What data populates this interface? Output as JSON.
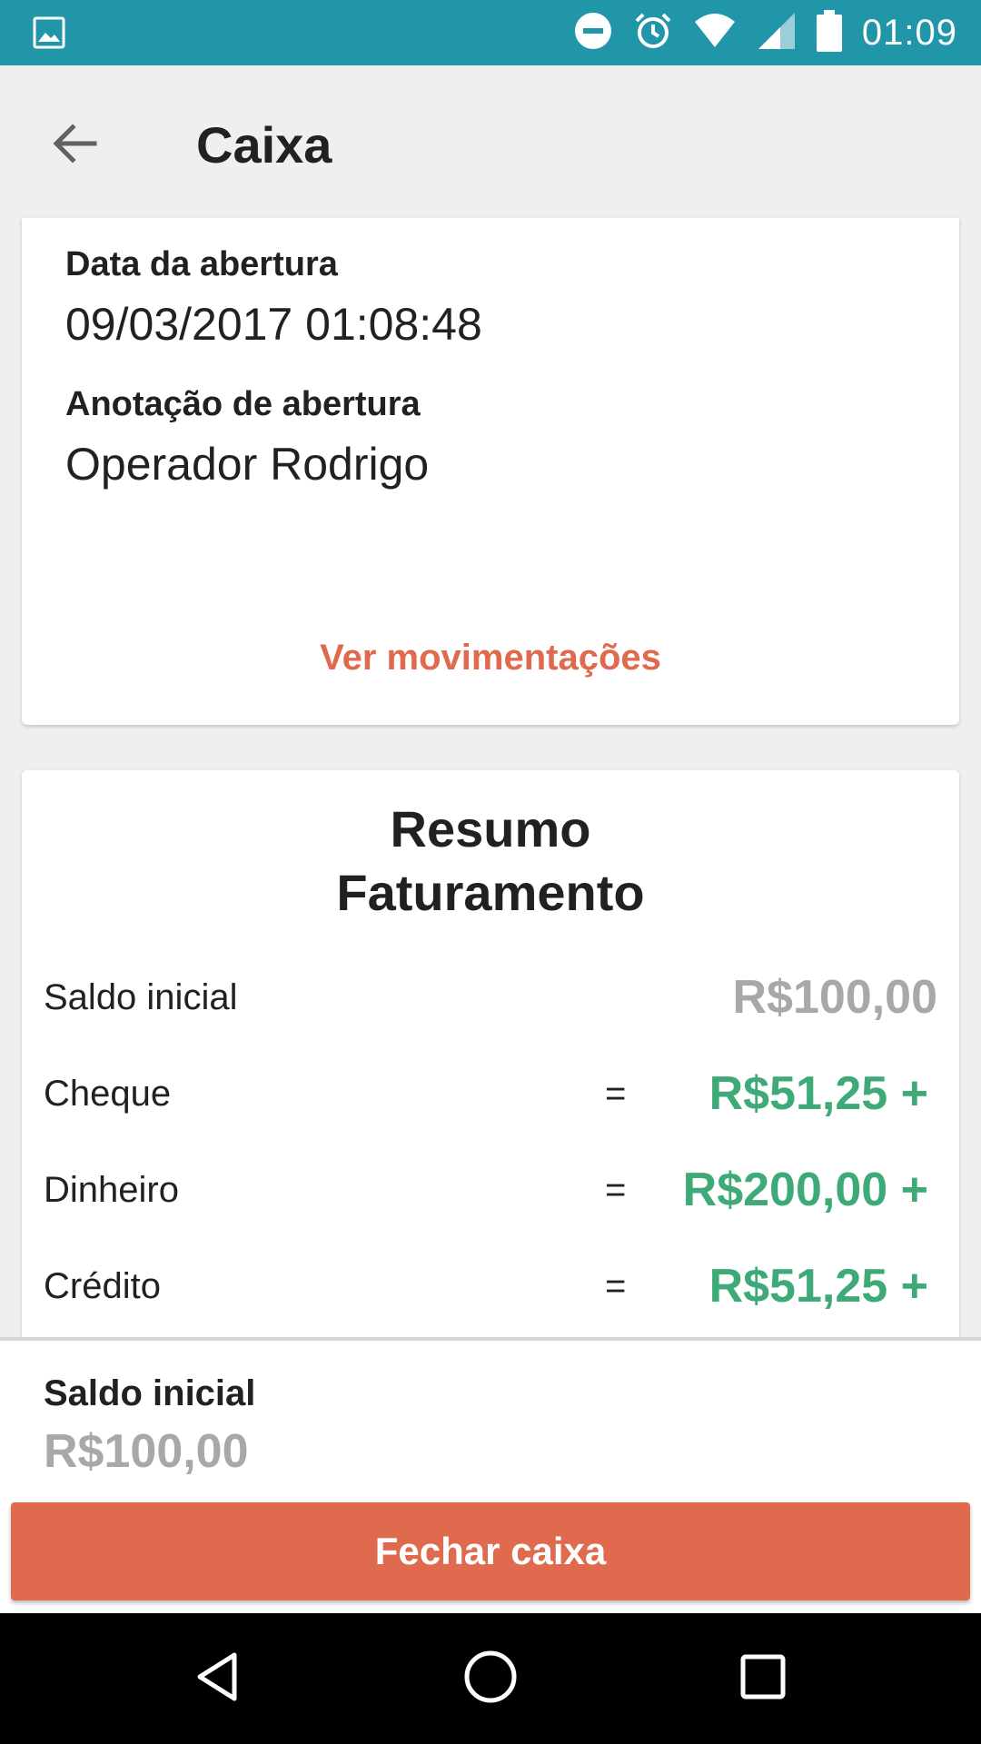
{
  "status_bar": {
    "time": "01:09",
    "icons": [
      "image-icon",
      "do-not-disturb-icon",
      "alarm-icon",
      "wifi-icon",
      "signal-icon",
      "battery-icon"
    ]
  },
  "app_bar": {
    "title": "Caixa",
    "back_icon": "arrow-back-icon"
  },
  "opening_card": {
    "date_label": "Data da abertura",
    "date_value": "09/03/2017 01:08:48",
    "note_label": "Anotação de abertura",
    "note_value": "Operador Rodrigo",
    "link_label": "Ver movimentações"
  },
  "summary": {
    "title_line1": "Resumo",
    "title_line2": "Faturamento",
    "rows": [
      {
        "label": "Saldo inicial",
        "eq": "",
        "value": "R$100,00"
      },
      {
        "label": "Cheque",
        "eq": "=",
        "value": "R$51,25 +"
      },
      {
        "label": "Dinheiro",
        "eq": "=",
        "value": "R$200,00 +"
      },
      {
        "label": "Crédito",
        "eq": "=",
        "value": "R$51,25 +"
      }
    ]
  },
  "bottom_sheet": {
    "label": "Saldo inicial",
    "value": "R$100,00",
    "button_label": "Fechar caixa"
  },
  "colors": {
    "status_bar": "#2196a8",
    "accent": "#e06a4e",
    "positive": "#3eaa78",
    "muted": "#a8a8a8"
  }
}
